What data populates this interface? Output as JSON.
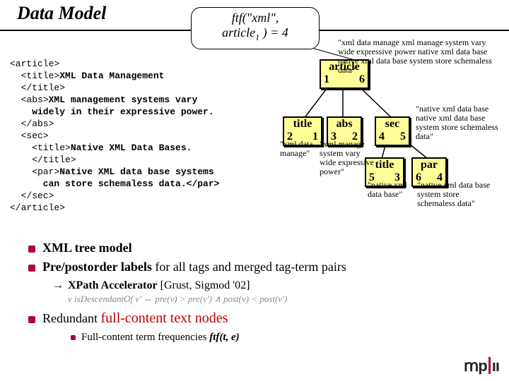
{
  "title": "Data Model",
  "ftf_line1": "ftf(\"xml\",",
  "ftf_line2_a": "article",
  "ftf_line2_sub": "1",
  "ftf_line2_b": " ) = 4",
  "xml_l1": "<article>",
  "xml_l2a": "  <title>",
  "xml_l2b": "XML Data Management",
  "xml_l3": "  </title>",
  "xml_l4a": "  <abs>",
  "xml_l4b": "XML management systems vary",
  "xml_l5": "    widely in their expressive power.",
  "xml_l6": "  </abs>",
  "xml_l7": "  <sec>",
  "xml_l8a": "    <title>",
  "xml_l8b": "Native XML Data Bases.",
  "xml_l9": "    </title>",
  "xml_l10a": "    <par>",
  "xml_l10b": "Native XML data base systems",
  "xml_l11": "      can store schemaless data.</par>",
  "xml_l12": "  </sec>",
  "xml_l13": "</article>",
  "node_article": "article",
  "node_article_l": "1",
  "node_article_r": "6",
  "node_title1": "title",
  "node_title1_l": "2",
  "node_title1_r": "1",
  "node_abs": "abs",
  "node_abs_l": "3",
  "node_abs_r": "2",
  "node_sec": "sec",
  "node_sec_l": "4",
  "node_sec_r": "5",
  "node_title2": "title",
  "node_title2_l": "5",
  "node_title2_r": "3",
  "node_par": "par",
  "node_par_l": "6",
  "node_par_r": "4",
  "annot_top": "\"xml data manage xml manage system vary wide expressive power native xml data base native xml data base system store schemaless data\"",
  "annot_title1": "\"xml data manage\"",
  "annot_abs": "\"xml manage system vary wide expressive power\"",
  "annot_sec": "\"native xml data base native xml data base system store schemaless data\"",
  "annot_title2": "\"native xml data base\"",
  "annot_par": "\"native xml data base system store schemaless data\"",
  "bul1a": "XML tree model",
  "bul1b_a": "Pre/postorder labels",
  "bul1b_b": " for all tags and merged tag-term pairs",
  "bul2": "XPath Accelerator",
  "bul2_cite": " [Grust, Sigmod '02]",
  "formula": "v isDescendantOf v' ⇔ pre(v) > pre(v') ∧ post(v) < post(v')",
  "bul3_a": "Redundant ",
  "bul3_b": "full-content text nodes",
  "bul4_a": "Full-content term frequencies ",
  "bul4_b": "ftf(t, e)"
}
